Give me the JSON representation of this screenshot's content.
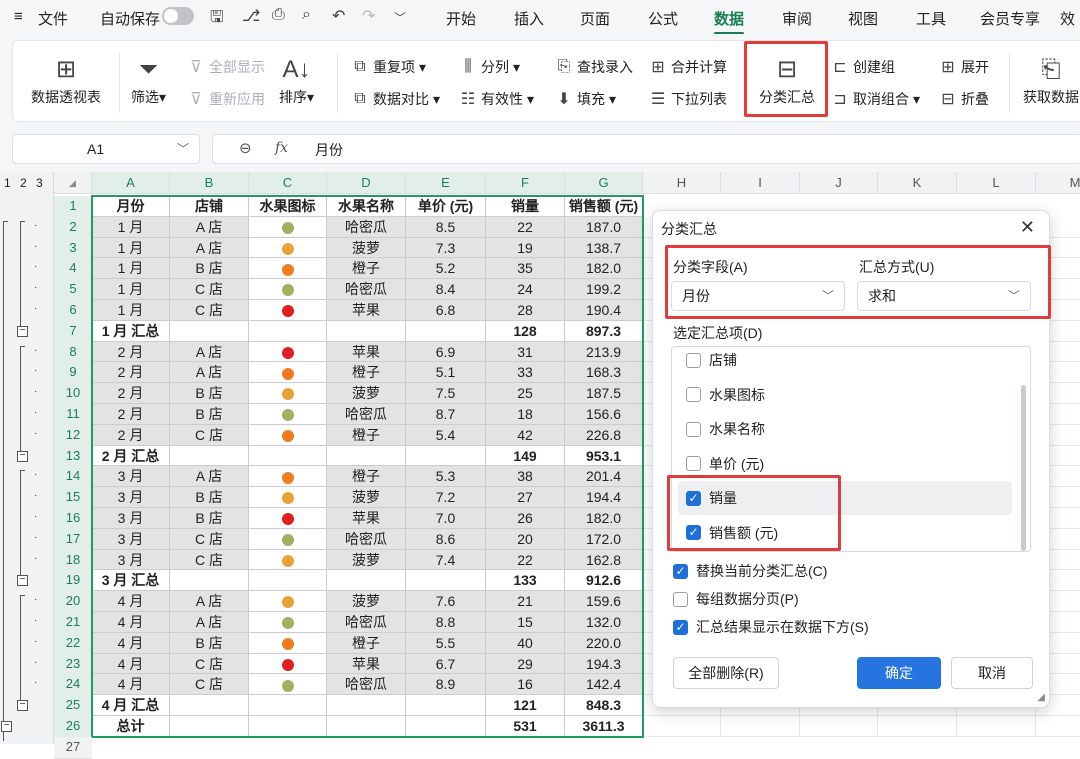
{
  "menubar": {
    "menu_icon": "≡",
    "file": "文件",
    "autosave": "自动保存",
    "tabs": [
      "开始",
      "插入",
      "页面",
      "公式",
      "数据",
      "审阅",
      "视图",
      "工具",
      "会员专享",
      "效"
    ],
    "active_tab": "数据"
  },
  "ribbon": {
    "pivot": "数据透视表",
    "filter": "筛选",
    "show_all": "全部显示",
    "reapply": "重新应用",
    "sort": "排序",
    "duplicates": "重复项",
    "compare": "数据对比",
    "split": "分列",
    "validity": "有效性",
    "lookup": "查找录入",
    "fill": "填充",
    "consolidate": "合并计算",
    "dropdown": "下拉列表",
    "subtotal": "分类汇总",
    "group": "创建组",
    "ungroup": "取消组合",
    "expand": "展开",
    "collapse": "折叠",
    "get_data": "获取数据"
  },
  "formula_bar": {
    "cell_ref": "A1",
    "fx": "fx",
    "content": "月份"
  },
  "sheet": {
    "outline_levels": [
      "1",
      "2",
      "3"
    ],
    "columns": [
      "A",
      "B",
      "C",
      "D",
      "E",
      "F",
      "G",
      "H",
      "I",
      "J",
      "K",
      "L",
      "M"
    ],
    "header_row": [
      "月份",
      "店铺",
      "水果图标",
      "水果名称",
      "单价 (元)",
      "销量",
      "销售额 (元)"
    ],
    "rows": [
      {
        "n": "2",
        "m": "1 月",
        "s": "A 店",
        "f": "哈密瓜",
        "p": "8.5",
        "q": "22",
        "a": "187.0",
        "c": "#9fb060"
      },
      {
        "n": "3",
        "m": "1 月",
        "s": "A 店",
        "f": "菠萝",
        "p": "7.3",
        "q": "19",
        "a": "138.7",
        "c": "#e8a23a"
      },
      {
        "n": "4",
        "m": "1 月",
        "s": "B 店",
        "f": "橙子",
        "p": "5.2",
        "q": "35",
        "a": "182.0",
        "c": "#f07a20"
      },
      {
        "n": "5",
        "m": "1 月",
        "s": "C 店",
        "f": "哈密瓜",
        "p": "8.4",
        "q": "24",
        "a": "199.2",
        "c": "#9fb060"
      },
      {
        "n": "6",
        "m": "1 月",
        "s": "C 店",
        "f": "苹果",
        "p": "6.8",
        "q": "28",
        "a": "190.4",
        "c": "#e02020"
      },
      {
        "n": "7",
        "m": "1 月 汇总",
        "s": "",
        "f": "",
        "p": "",
        "q": "128",
        "a": "897.3",
        "c": "",
        "sum": true
      },
      {
        "n": "8",
        "m": "2 月",
        "s": "A 店",
        "f": "苹果",
        "p": "6.9",
        "q": "31",
        "a": "213.9",
        "c": "#e02020"
      },
      {
        "n": "9",
        "m": "2 月",
        "s": "A 店",
        "f": "橙子",
        "p": "5.1",
        "q": "33",
        "a": "168.3",
        "c": "#f07a20"
      },
      {
        "n": "10",
        "m": "2 月",
        "s": "B 店",
        "f": "菠萝",
        "p": "7.5",
        "q": "25",
        "a": "187.5",
        "c": "#e8a23a"
      },
      {
        "n": "11",
        "m": "2 月",
        "s": "B 店",
        "f": "哈密瓜",
        "p": "8.7",
        "q": "18",
        "a": "156.6",
        "c": "#9fb060"
      },
      {
        "n": "12",
        "m": "2 月",
        "s": "C 店",
        "f": "橙子",
        "p": "5.4",
        "q": "42",
        "a": "226.8",
        "c": "#f07a20"
      },
      {
        "n": "13",
        "m": "2 月 汇总",
        "s": "",
        "f": "",
        "p": "",
        "q": "149",
        "a": "953.1",
        "c": "",
        "sum": true
      },
      {
        "n": "14",
        "m": "3 月",
        "s": "A 店",
        "f": "橙子",
        "p": "5.3",
        "q": "38",
        "a": "201.4",
        "c": "#f07a20"
      },
      {
        "n": "15",
        "m": "3 月",
        "s": "B 店",
        "f": "菠萝",
        "p": "7.2",
        "q": "27",
        "a": "194.4",
        "c": "#e8a23a"
      },
      {
        "n": "16",
        "m": "3 月",
        "s": "B 店",
        "f": "苹果",
        "p": "7.0",
        "q": "26",
        "a": "182.0",
        "c": "#e02020"
      },
      {
        "n": "17",
        "m": "3 月",
        "s": "C 店",
        "f": "哈密瓜",
        "p": "8.6",
        "q": "20",
        "a": "172.0",
        "c": "#9fb060"
      },
      {
        "n": "18",
        "m": "3 月",
        "s": "C 店",
        "f": "菠萝",
        "p": "7.4",
        "q": "22",
        "a": "162.8",
        "c": "#e8a23a"
      },
      {
        "n": "19",
        "m": "3 月 汇总",
        "s": "",
        "f": "",
        "p": "",
        "q": "133",
        "a": "912.6",
        "c": "",
        "sum": true
      },
      {
        "n": "20",
        "m": "4 月",
        "s": "A 店",
        "f": "菠萝",
        "p": "7.6",
        "q": "21",
        "a": "159.6",
        "c": "#e8a23a"
      },
      {
        "n": "21",
        "m": "4 月",
        "s": "A 店",
        "f": "哈密瓜",
        "p": "8.8",
        "q": "15",
        "a": "132.0",
        "c": "#9fb060"
      },
      {
        "n": "22",
        "m": "4 月",
        "s": "B 店",
        "f": "橙子",
        "p": "5.5",
        "q": "40",
        "a": "220.0",
        "c": "#f07a20"
      },
      {
        "n": "23",
        "m": "4 月",
        "s": "C 店",
        "f": "苹果",
        "p": "6.7",
        "q": "29",
        "a": "194.3",
        "c": "#e02020"
      },
      {
        "n": "24",
        "m": "4 月",
        "s": "C 店",
        "f": "哈密瓜",
        "p": "8.9",
        "q": "16",
        "a": "142.4",
        "c": "#9fb060"
      },
      {
        "n": "25",
        "m": "4 月 汇总",
        "s": "",
        "f": "",
        "p": "",
        "q": "121",
        "a": "848.3",
        "c": "",
        "sum": true
      },
      {
        "n": "26",
        "m": "总计",
        "s": "",
        "f": "",
        "p": "",
        "q": "531",
        "a": "3611.3",
        "c": "",
        "sum": true
      }
    ]
  },
  "dialog": {
    "title": "分类汇总",
    "close": "✕",
    "group_by_label": "分类字段(A)",
    "group_by_value": "月份",
    "method_label": "汇总方式(U)",
    "method_value": "求和",
    "items_label": "选定汇总项(D)",
    "items": [
      {
        "label": "店铺",
        "checked": false
      },
      {
        "label": "水果图标",
        "checked": false
      },
      {
        "label": "水果名称",
        "checked": false
      },
      {
        "label": "单价 (元)",
        "checked": false
      },
      {
        "label": "销量",
        "checked": true
      },
      {
        "label": "销售额 (元)",
        "checked": true
      }
    ],
    "replace_label": "替换当前分类汇总(C)",
    "pagebreak_label": "每组数据分页(P)",
    "below_label": "汇总结果显示在数据下方(S)",
    "remove_all": "全部删除(R)",
    "ok": "确定",
    "cancel": "取消"
  }
}
